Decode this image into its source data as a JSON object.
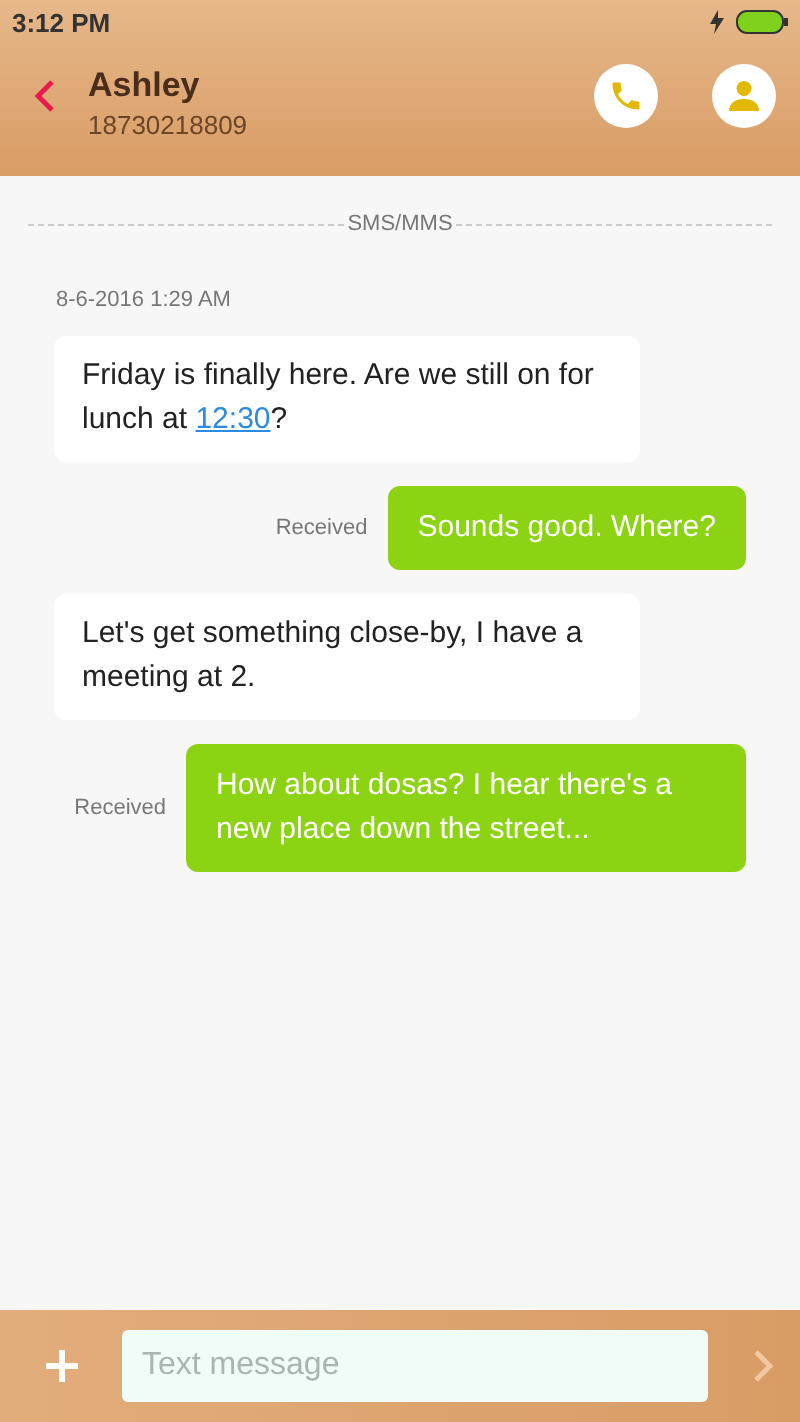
{
  "status_bar": {
    "time": "3:12 PM",
    "charging": true
  },
  "header": {
    "contact_name": "Ashley",
    "phone_number": "18730218809"
  },
  "conversation": {
    "divider_label": "SMS/MMS",
    "timestamp": "8-6-2016 1:29 AM",
    "messages": [
      {
        "kind": "incoming",
        "parts": [
          {
            "text": "Friday is finally here. Are we still on for lunch at "
          },
          {
            "text": "12:30",
            "link": true
          },
          {
            "text": "?"
          }
        ]
      },
      {
        "kind": "outgoing",
        "status": "Received",
        "parts": [
          {
            "text": "Sounds good. Where?"
          }
        ]
      },
      {
        "kind": "incoming",
        "parts": [
          {
            "text": "Let's get something close-by, I have a meeting at 2."
          }
        ]
      },
      {
        "kind": "outgoing",
        "status": "Received",
        "parts": [
          {
            "text": "How about dosas? I hear there's a new place down the street..."
          }
        ]
      }
    ]
  },
  "composer": {
    "placeholder": "Text message"
  }
}
